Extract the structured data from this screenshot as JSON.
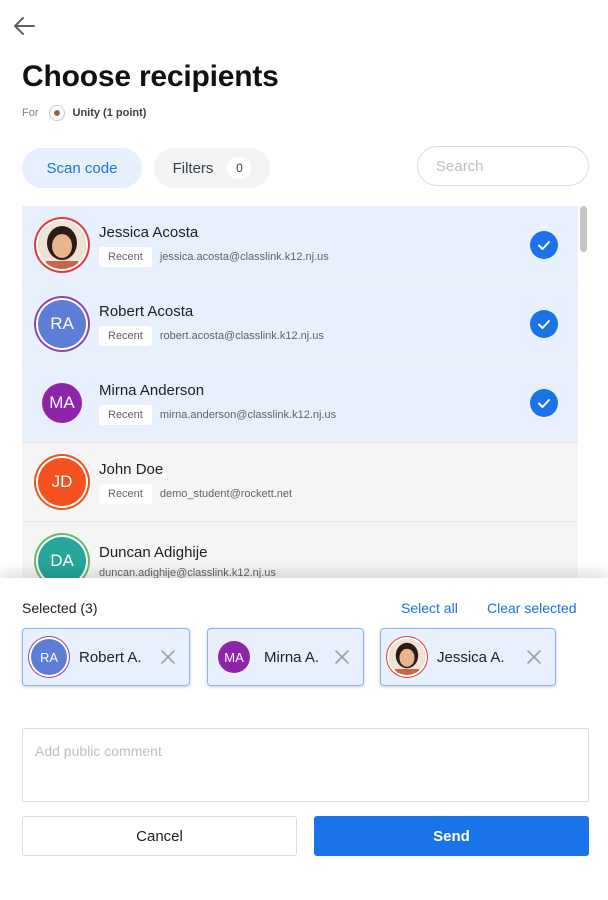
{
  "header": {
    "title": "Choose recipients",
    "for_label": "For",
    "for_value": "Unity (1 point)"
  },
  "toolbar": {
    "scan_label": "Scan code",
    "filters_label": "Filters",
    "filters_count": "0",
    "search_placeholder": "Search"
  },
  "recipients": [
    {
      "name": "Jessica Acosta",
      "tag": "Recent",
      "email": "jessica.acosta@classlink.k12.nj.us",
      "initials": "",
      "avatar_color": "#e8a07a",
      "ring_color": "#e53935",
      "selected": true
    },
    {
      "name": "Robert Acosta",
      "tag": "Recent",
      "email": "robert.acosta@classlink.k12.nj.us",
      "initials": "RA",
      "avatar_color": "#5c7ed8",
      "ring_color": "#8e44ad",
      "selected": true
    },
    {
      "name": "Mirna Anderson",
      "tag": "Recent",
      "email": "mirna.anderson@classlink.k12.nj.us",
      "initials": "MA",
      "avatar_color": "#8e24aa",
      "ring_color": "",
      "selected": true
    },
    {
      "name": "John Doe",
      "tag": "Recent",
      "email": "demo_student@rockett.net",
      "initials": "JD",
      "avatar_color": "#f4511e",
      "ring_color": "#f4511e",
      "selected": false
    },
    {
      "name": "Duncan Adighije",
      "tag": "",
      "email": "duncan.adighije@classlink.k12.nj.us",
      "initials": "DA",
      "avatar_color": "#26a69a",
      "ring_color": "#66bb6a",
      "selected": false
    }
  ],
  "selection": {
    "label": "Selected (3)",
    "select_all": "Select all",
    "clear_selected": "Clear selected",
    "chips": [
      {
        "name": "Robert A.",
        "initials": "RA",
        "avatar_color": "#5c7ed8"
      },
      {
        "name": "Mirna A.",
        "initials": "MA",
        "avatar_color": "#8e24aa"
      },
      {
        "name": "Jessica A.",
        "initials": "",
        "avatar_color": "#e8a07a"
      }
    ]
  },
  "comment": {
    "placeholder": "Add public comment"
  },
  "actions": {
    "cancel_label": "Cancel",
    "send_label": "Send"
  },
  "colors": {
    "accent": "#1a73e8",
    "selected_bg": "#e8f0fe"
  },
  "icons": {
    "back": "arrow-left-icon",
    "check": "check-circle-icon",
    "remove": "close-icon",
    "unity": "unity-badge-icon"
  }
}
